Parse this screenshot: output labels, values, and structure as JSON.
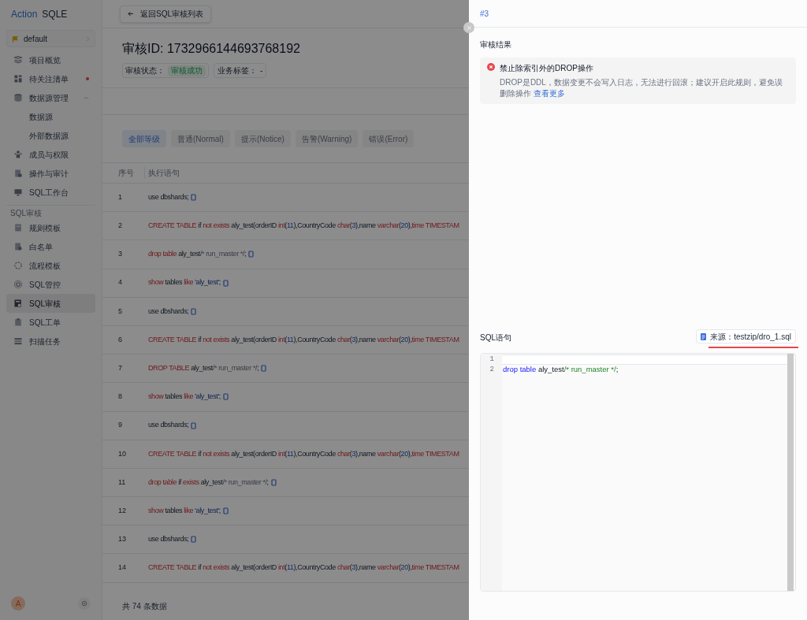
{
  "brand": {
    "first": "Action",
    "second": "SQLE"
  },
  "project_selector": {
    "label": "default"
  },
  "sidebar": {
    "groups": [
      {
        "items": [
          {
            "label": "项目概览",
            "selected": false,
            "alert": false
          },
          {
            "label": "待关注清单",
            "selected": false,
            "alert": true
          },
          {
            "label": "数据源管理",
            "selected": false,
            "alert": false,
            "expanded": true,
            "children": [
              {
                "label": "数据源",
                "selected": false
              },
              {
                "label": "外部数据源",
                "selected": false
              }
            ]
          },
          {
            "label": "成员与权限",
            "selected": false,
            "alert": false
          },
          {
            "label": "操作与审计",
            "selected": false,
            "alert": false
          },
          {
            "label": "SQL工作台",
            "selected": false,
            "alert": false
          }
        ]
      },
      {
        "title": "SQL审核",
        "items": [
          {
            "label": "规则模板",
            "selected": false,
            "alert": false
          },
          {
            "label": "白名单",
            "selected": false,
            "alert": false
          },
          {
            "label": "流程模板",
            "selected": false,
            "alert": false
          },
          {
            "label": "SQL管控",
            "selected": false,
            "alert": false
          },
          {
            "label": "SQL审核",
            "selected": true,
            "alert": false
          },
          {
            "label": "SQL工单",
            "selected": false,
            "alert": false
          },
          {
            "label": "扫描任务",
            "selected": false,
            "alert": false
          }
        ]
      }
    ],
    "user_avatar": "A"
  },
  "main": {
    "back_button": "返回SQL审核列表",
    "title": "审核ID: 1732966144693768192",
    "status": {
      "label": "审核状态：",
      "value": "审核成功"
    },
    "business_tag": {
      "label": "业务标签：",
      "value": "-"
    },
    "level_tabs": [
      {
        "label": "全部等级",
        "selected": true
      },
      {
        "label": "普通(Normal)",
        "selected": false
      },
      {
        "label": "提示(Notice)",
        "selected": false
      },
      {
        "label": "告警(Warning)",
        "selected": false
      },
      {
        "label": "错误(Error)",
        "selected": false
      }
    ],
    "table": {
      "columns": [
        "序号",
        "执行语句"
      ],
      "rows": [
        {
          "number": "1",
          "copyable": true,
          "segments": [
            {
              "kind": "plain",
              "text": "use dbshards;"
            }
          ]
        },
        {
          "number": "2",
          "copyable": false,
          "segments": [
            {
              "kind": "keyword",
              "text": "CREATE TABLE"
            },
            {
              "kind": "plain",
              "text": " if "
            },
            {
              "kind": "keyword",
              "text": "not exists"
            },
            {
              "kind": "plain",
              "text": " aly_test(orderID "
            },
            {
              "kind": "keyword",
              "text": "int"
            },
            {
              "kind": "plain",
              "text": "("
            },
            {
              "kind": "number",
              "text": "11"
            },
            {
              "kind": "plain",
              "text": "),CountryCode "
            },
            {
              "kind": "keyword",
              "text": "char"
            },
            {
              "kind": "plain",
              "text": "("
            },
            {
              "kind": "number",
              "text": "3"
            },
            {
              "kind": "plain",
              "text": "),name "
            },
            {
              "kind": "keyword",
              "text": "varchar"
            },
            {
              "kind": "plain",
              "text": "("
            },
            {
              "kind": "number",
              "text": "20"
            },
            {
              "kind": "plain",
              "text": "),"
            },
            {
              "kind": "keyword",
              "text": "time TIMESTAM"
            }
          ]
        },
        {
          "number": "3",
          "copyable": true,
          "segments": [
            {
              "kind": "keyword",
              "text": "drop table"
            },
            {
              "kind": "plain",
              "text": " aly_test"
            },
            {
              "kind": "comment",
              "text": "/* run_master */"
            },
            {
              "kind": "plain",
              "text": ";"
            }
          ]
        },
        {
          "number": "4",
          "copyable": true,
          "segments": [
            {
              "kind": "keyword",
              "text": "show"
            },
            {
              "kind": "plain",
              "text": " tables "
            },
            {
              "kind": "keyword",
              "text": "like"
            },
            {
              "kind": "string",
              "text": " 'aly_test'"
            },
            {
              "kind": "plain",
              "text": ";"
            }
          ]
        },
        {
          "number": "5",
          "copyable": true,
          "segments": [
            {
              "kind": "plain",
              "text": "use dbshards;"
            }
          ]
        },
        {
          "number": "6",
          "copyable": false,
          "segments": [
            {
              "kind": "keyword",
              "text": "CREATE TABLE"
            },
            {
              "kind": "plain",
              "text": " if "
            },
            {
              "kind": "keyword",
              "text": "not exists"
            },
            {
              "kind": "plain",
              "text": " aly_test(orderID "
            },
            {
              "kind": "keyword",
              "text": "int"
            },
            {
              "kind": "plain",
              "text": "("
            },
            {
              "kind": "number",
              "text": "11"
            },
            {
              "kind": "plain",
              "text": "),CountryCode "
            },
            {
              "kind": "keyword",
              "text": "char"
            },
            {
              "kind": "plain",
              "text": "("
            },
            {
              "kind": "number",
              "text": "3"
            },
            {
              "kind": "plain",
              "text": "),name "
            },
            {
              "kind": "keyword",
              "text": "varchar"
            },
            {
              "kind": "plain",
              "text": "("
            },
            {
              "kind": "number",
              "text": "20"
            },
            {
              "kind": "plain",
              "text": "),"
            },
            {
              "kind": "keyword",
              "text": "time TIMESTAM"
            }
          ]
        },
        {
          "number": "7",
          "copyable": true,
          "segments": [
            {
              "kind": "keyword",
              "text": "DROP TABLE"
            },
            {
              "kind": "plain",
              "text": " aly_test"
            },
            {
              "kind": "comment",
              "text": "/* run_master */"
            },
            {
              "kind": "plain",
              "text": ";"
            }
          ]
        },
        {
          "number": "8",
          "copyable": true,
          "segments": [
            {
              "kind": "keyword",
              "text": "show"
            },
            {
              "kind": "plain",
              "text": " tables "
            },
            {
              "kind": "keyword",
              "text": "like"
            },
            {
              "kind": "string",
              "text": " 'aly_test'"
            },
            {
              "kind": "plain",
              "text": ";"
            }
          ]
        },
        {
          "number": "9",
          "copyable": true,
          "segments": [
            {
              "kind": "plain",
              "text": "use dbshards;"
            }
          ]
        },
        {
          "number": "10",
          "copyable": false,
          "segments": [
            {
              "kind": "keyword",
              "text": "CREATE TABLE"
            },
            {
              "kind": "plain",
              "text": " if "
            },
            {
              "kind": "keyword",
              "text": "not exists"
            },
            {
              "kind": "plain",
              "text": " aly_test(orderID "
            },
            {
              "kind": "keyword",
              "text": "int"
            },
            {
              "kind": "plain",
              "text": "("
            },
            {
              "kind": "number",
              "text": "11"
            },
            {
              "kind": "plain",
              "text": "),CountryCode "
            },
            {
              "kind": "keyword",
              "text": "char"
            },
            {
              "kind": "plain",
              "text": "("
            },
            {
              "kind": "number",
              "text": "3"
            },
            {
              "kind": "plain",
              "text": "),name "
            },
            {
              "kind": "keyword",
              "text": "varchar"
            },
            {
              "kind": "plain",
              "text": "("
            },
            {
              "kind": "number",
              "text": "20"
            },
            {
              "kind": "plain",
              "text": "),"
            },
            {
              "kind": "keyword",
              "text": "time TIMESTAM"
            }
          ]
        },
        {
          "number": "11",
          "copyable": true,
          "segments": [
            {
              "kind": "keyword",
              "text": "drop table"
            },
            {
              "kind": "plain",
              "text": " if "
            },
            {
              "kind": "keyword",
              "text": "exists"
            },
            {
              "kind": "plain",
              "text": " aly_test"
            },
            {
              "kind": "comment",
              "text": "/* run_master */"
            },
            {
              "kind": "plain",
              "text": ";"
            }
          ]
        },
        {
          "number": "12",
          "copyable": true,
          "segments": [
            {
              "kind": "keyword",
              "text": "show"
            },
            {
              "kind": "plain",
              "text": " tables "
            },
            {
              "kind": "keyword",
              "text": "like"
            },
            {
              "kind": "string",
              "text": " 'aly_test'"
            },
            {
              "kind": "plain",
              "text": ";"
            }
          ]
        },
        {
          "number": "13",
          "copyable": true,
          "segments": [
            {
              "kind": "plain",
              "text": "use dbshards;"
            }
          ]
        },
        {
          "number": "14",
          "copyable": false,
          "segments": [
            {
              "kind": "keyword",
              "text": "CREATE TABLE"
            },
            {
              "kind": "plain",
              "text": " if "
            },
            {
              "kind": "keyword",
              "text": "not exists"
            },
            {
              "kind": "plain",
              "text": " aly_test(orderID "
            },
            {
              "kind": "keyword",
              "text": "int"
            },
            {
              "kind": "plain",
              "text": "("
            },
            {
              "kind": "number",
              "text": "11"
            },
            {
              "kind": "plain",
              "text": "),CountryCode "
            },
            {
              "kind": "keyword",
              "text": "char"
            },
            {
              "kind": "plain",
              "text": "("
            },
            {
              "kind": "number",
              "text": "3"
            },
            {
              "kind": "plain",
              "text": "),name "
            },
            {
              "kind": "keyword",
              "text": "varchar"
            },
            {
              "kind": "plain",
              "text": "("
            },
            {
              "kind": "number",
              "text": "20"
            },
            {
              "kind": "plain",
              "text": "),"
            },
            {
              "kind": "keyword",
              "text": "time TIMESTAM"
            }
          ]
        }
      ]
    },
    "total": "共 74 条数据"
  },
  "drawer": {
    "title": "#3",
    "result_heading": "审核结果",
    "results": [
      {
        "kind": "error",
        "title": "禁止除索引外的DROP操作",
        "description": "DROP是DDL，数据变更不会写入日志，无法进行回滚；建议开启此规则，避免误删除操作",
        "link": "查看更多"
      }
    ],
    "sql_heading": "SQL语句",
    "source": "来源：testzip/dro_1.sql",
    "code_lines": [
      {
        "number": "1",
        "active": true
      },
      {
        "number": "2",
        "active": false,
        "segments": [
          {
            "kind": "keyword",
            "text": "drop table"
          },
          {
            "kind": "plain",
            "text": " aly_test"
          },
          {
            "kind": "comment",
            "text": "/* run_master */"
          },
          {
            "kind": "plain",
            "text": ";"
          }
        ]
      }
    ]
  }
}
